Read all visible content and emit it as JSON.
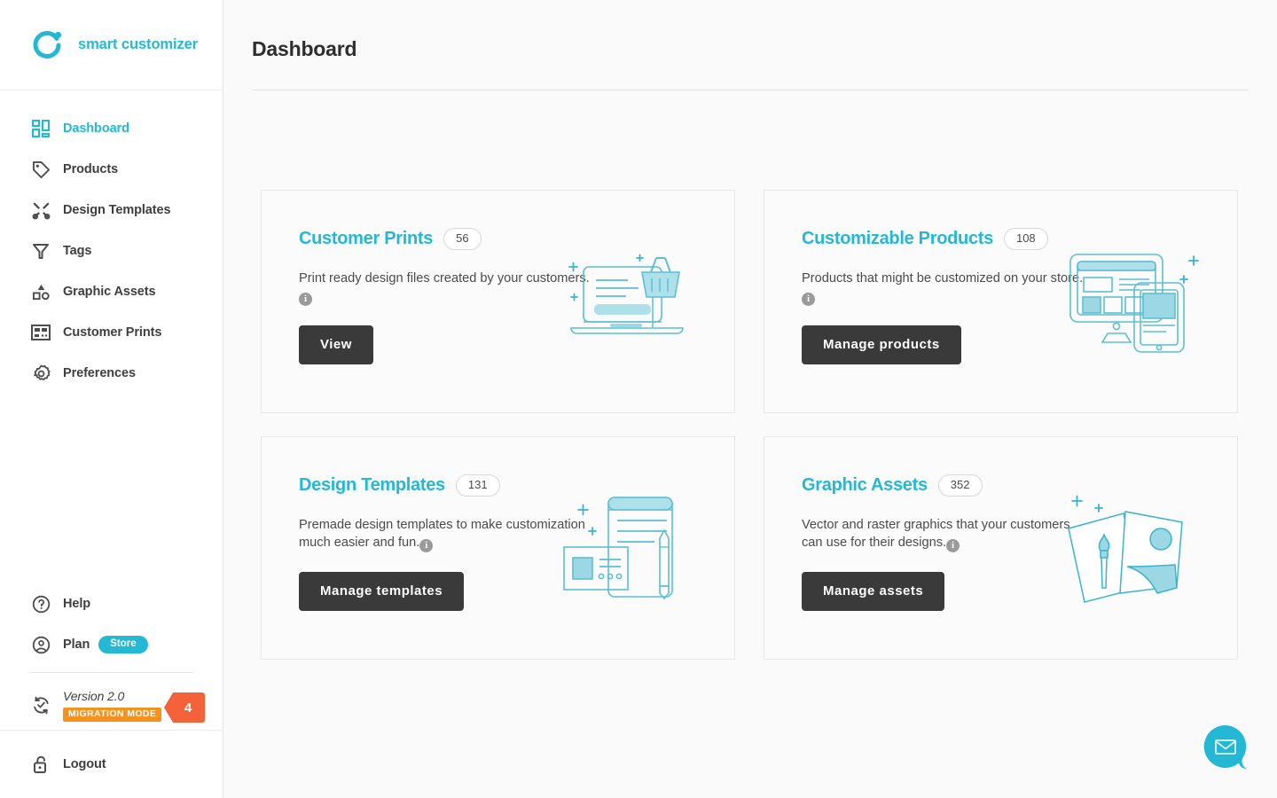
{
  "brand": {
    "name": "smart customizer",
    "logo_icon": "ring-dot-logo-icon",
    "accent_color": "#24b8d4"
  },
  "sidebar": {
    "nav": [
      {
        "label": "Dashboard",
        "icon": "grid-icon",
        "active": true
      },
      {
        "label": "Products",
        "icon": "tag-icon",
        "active": false
      },
      {
        "label": "Design Templates",
        "icon": "scissors-icon",
        "active": false
      },
      {
        "label": "Tags",
        "icon": "funnel-icon",
        "active": false
      },
      {
        "label": "Graphic Assets",
        "icon": "shapes-icon",
        "active": false
      },
      {
        "label": "Customer Prints",
        "icon": "print-rows-icon",
        "active": false
      },
      {
        "label": "Preferences",
        "icon": "gear-icon",
        "active": false
      }
    ],
    "help": {
      "label": "Help",
      "icon": "question-circle-icon"
    },
    "plan": {
      "label": "Plan",
      "icon": "user-circle-icon",
      "badge": "Store",
      "badge_color": "#24b8d4"
    },
    "version": {
      "label": "Version 2.0",
      "icon": "sync-check-icon",
      "mode_badge": "MIGRATION MODE",
      "mode_badge_color": "#f5921e",
      "count": "4",
      "count_color": "#f4623a"
    },
    "logout": {
      "label": "Logout",
      "icon": "unlock-icon"
    }
  },
  "header": {
    "title": "Dashboard"
  },
  "cards": [
    {
      "title": "Customer Prints",
      "count": "56",
      "description": "Print ready design files created by your customers.",
      "info_icon": "info-icon",
      "button": "View",
      "illustration": "laptop-basket-illustration"
    },
    {
      "title": "Customizable Products",
      "count": "108",
      "description": "Products that might be customized on your store.",
      "info_icon": "info-icon",
      "button": "Manage products",
      "illustration": "monitor-tablet-illustration"
    },
    {
      "title": "Design Templates",
      "count": "131",
      "description": "Premade design templates to make customization much easier and fun.",
      "info_icon": "info-icon",
      "button": "Manage templates",
      "illustration": "document-pencil-illustration"
    },
    {
      "title": "Graphic Assets",
      "count": "352",
      "description": "Vector and raster graphics that your customers can use for their designs.",
      "info_icon": "info-icon",
      "button": "Manage assets",
      "illustration": "papers-brush-illustration"
    }
  ],
  "chat": {
    "icon": "envelope-chat-icon",
    "color": "#24b8d4"
  }
}
